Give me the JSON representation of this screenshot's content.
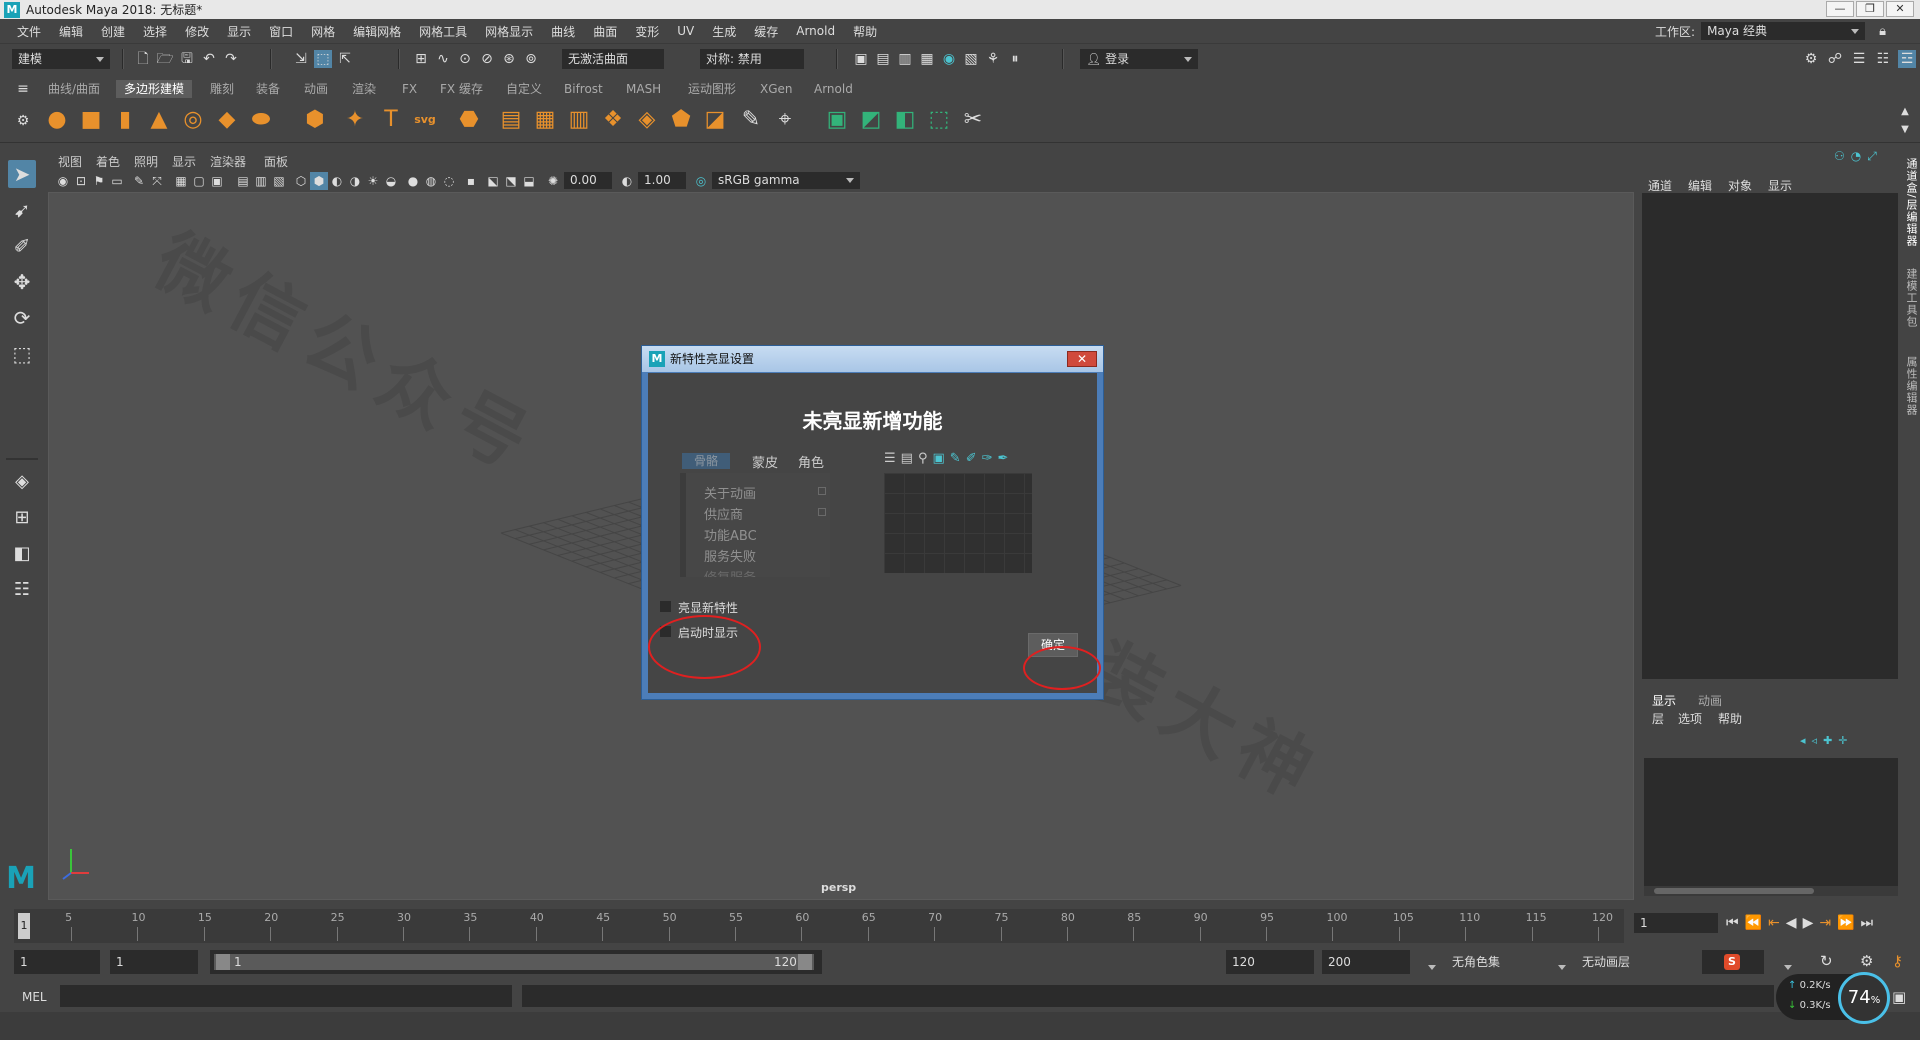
{
  "window": {
    "title": "Autodesk Maya 2018: 无标题*",
    "logo": "M",
    "min_glyph": "—",
    "max_glyph": "❐",
    "close_glyph": "✕"
  },
  "menubar": {
    "items": [
      "文件",
      "编辑",
      "创建",
      "选择",
      "修改",
      "显示",
      "窗口",
      "网格",
      "编辑网格",
      "网格工具",
      "网格显示",
      "曲线",
      "曲面",
      "变形",
      "UV",
      "生成",
      "缓存",
      "Arnold",
      "帮助"
    ]
  },
  "workspace": {
    "label": "工作区:",
    "value": "Maya 经典"
  },
  "statusline": {
    "mode": "建模",
    "live_surface": "无激活曲面",
    "symmetry": "对称: 禁用",
    "login": "登录"
  },
  "shelf": {
    "tabs": [
      "曲线/曲面",
      "多边形建模",
      "雕刻",
      "装备",
      "动画",
      "渲染",
      "FX",
      "FX 缓存",
      "自定义",
      "Bifrost",
      "MASH",
      "运动图形",
      "XGen",
      "Arnold"
    ],
    "active_tab": "多边形建模",
    "icons": [
      {
        "name": "sphere-icon",
        "color": "#e8912c",
        "glyph": "●"
      },
      {
        "name": "cube-icon",
        "color": "#e8912c",
        "glyph": "■"
      },
      {
        "name": "cylinder-icon",
        "color": "#e8912c",
        "glyph": "▮"
      },
      {
        "name": "cone-icon",
        "color": "#e8912c",
        "glyph": "▲"
      },
      {
        "name": "torus-icon",
        "color": "#e8912c",
        "glyph": "◎"
      },
      {
        "name": "plane-icon",
        "color": "#e8912c",
        "glyph": "◆"
      },
      {
        "name": "disc-icon",
        "color": "#e8912c",
        "glyph": "⬬"
      },
      {
        "name": "platonic-icon",
        "color": "#e8912c",
        "glyph": "⬢"
      },
      {
        "name": "super-shape-icon",
        "color": "#e8912c",
        "glyph": "✦"
      },
      {
        "name": "text-icon",
        "color": "#e8912c",
        "glyph": "T"
      },
      {
        "name": "svg-icon",
        "color": "#e8912c",
        "glyph": "svg"
      },
      {
        "name": "smooth-icon",
        "color": "#e8912c",
        "glyph": "⬣"
      },
      {
        "name": "extrude-icon",
        "color": "#e8912c",
        "glyph": "▤"
      },
      {
        "name": "bridge-icon",
        "color": "#e8912c",
        "glyph": "▦"
      },
      {
        "name": "bevel-icon",
        "color": "#e8912c",
        "glyph": "▥"
      },
      {
        "name": "combine-icon",
        "color": "#e8912c",
        "glyph": "❖"
      },
      {
        "name": "separate-icon",
        "color": "#e8912c",
        "glyph": "◈"
      },
      {
        "name": "boolean-icon",
        "color": "#e8912c",
        "glyph": "⬟"
      },
      {
        "name": "mirror-icon",
        "color": "#e8912c",
        "glyph": "◪"
      },
      {
        "name": "multi-cut-icon",
        "color": "#dddddd",
        "glyph": "✎"
      },
      {
        "name": "target-weld-icon",
        "color": "#dddddd",
        "glyph": "⌖"
      },
      {
        "name": "uv-editor-icon",
        "color": "#33b37a",
        "glyph": "▣"
      },
      {
        "name": "unfold-icon",
        "color": "#33b37a",
        "glyph": "◩"
      },
      {
        "name": "layout-icon",
        "color": "#33b37a",
        "glyph": "◧"
      },
      {
        "name": "planar-map-icon",
        "color": "#33b37a",
        "glyph": "⬚"
      },
      {
        "name": "sew-icon",
        "color": "#dddddd",
        "glyph": "✂"
      }
    ]
  },
  "viewport": {
    "menu": [
      "视图",
      "着色",
      "照明",
      "显示",
      "渲染器",
      "面板"
    ],
    "exposure": "0.00",
    "gamma": "1.00",
    "color_space": "sRGB gamma",
    "camera_label": "persp",
    "watermark_lines": [
      "微信公众号",
      "软件安装大神"
    ]
  },
  "dialog": {
    "title": "新特性亮显设置",
    "heading": "未亮显新增功能",
    "tabs": [
      "骨骼",
      "蒙皮",
      "角色"
    ],
    "list": [
      "关于动画",
      "供应商",
      "功能ABC",
      "服务失败",
      "修复服务"
    ],
    "checkbox_highlight": "亮显新特性",
    "checkbox_startup": "启动时显示",
    "ok_label": "确定"
  },
  "channelbox": {
    "menu": [
      "通道",
      "编辑",
      "对象",
      "显示"
    ],
    "side_tabs": [
      "通道盒/层编辑器",
      "建模工具包",
      "属性编辑器"
    ]
  },
  "layers": {
    "tabs": [
      "显示",
      "动画"
    ],
    "menu": [
      "层",
      "选项",
      "帮助"
    ]
  },
  "timeline": {
    "current_frame": "1",
    "ticks": [
      "5",
      "10",
      "15",
      "20",
      "25",
      "30",
      "35",
      "40",
      "45",
      "50",
      "55",
      "60",
      "65",
      "70",
      "75",
      "80",
      "85",
      "90",
      "95",
      "100",
      "105",
      "110",
      "115",
      "120"
    ],
    "frame_field": "1"
  },
  "range": {
    "start": "1",
    "playback_start": "1",
    "slider_start": "1",
    "slider_end": "120",
    "playback_end": "120",
    "end": "200",
    "character_set": "无角色集",
    "anim_layer": "无动画层"
  },
  "cmdline": {
    "label": "MEL"
  },
  "netspeed": {
    "up": "0.2K/s",
    "down": "0.3K/s",
    "percent": "74",
    "percent_unit": "%"
  }
}
